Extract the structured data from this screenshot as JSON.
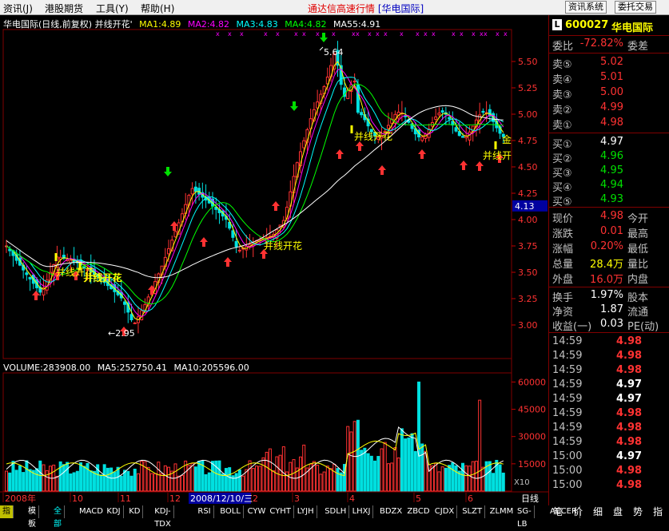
{
  "menubar": {
    "items": [
      "资讯(J)",
      "港股期货",
      "工具(Y)",
      "帮助(H)"
    ],
    "title": "通达信高速行情",
    "title_stock": "[华电国际]",
    "btn_info": "资讯系统",
    "btn_trade": "委托交易"
  },
  "chart_header": {
    "name": "华电国际(日线,前复权) 并线开花'",
    "ma1": "MA1:4.89",
    "ma2": "MA2:4.82",
    "ma3": "MA3:4.83",
    "ma4": "MA4:4.82",
    "ma5": "MA55:4.91"
  },
  "volume_header": {
    "vol": "VOLUME:283908.00",
    "ma5": "MA5:252750.41",
    "ma10": "MA10:205596.00"
  },
  "price_axis": [
    "5.50",
    "5.25",
    "5.00",
    "4.75",
    "4.50",
    "4.25",
    "4.00",
    "3.75",
    "3.50",
    "3.25",
    "3.00"
  ],
  "price_cursor": "4.13",
  "volume_axis": [
    "60000",
    "45000",
    "30000",
    "15000"
  ],
  "volume_unit": "X10",
  "time_axis": [
    "2008年",
    "10",
    "11",
    "12",
    "2",
    "3",
    "4",
    "5",
    "6"
  ],
  "time_highlight": "2008/12/10/三",
  "period_label": "日线",
  "annotations": {
    "high": "5.64",
    "low": "←2.95",
    "signal1": "并线开花",
    "signal2": "并线开花",
    "signal3": "并线开花",
    "signal4": "并线开花",
    "signal5": "并线开",
    "signal6": "并线开花",
    "signal7": "金"
  },
  "quote": {
    "code": "600027",
    "name": "华电国际",
    "icon": "L",
    "weibi_label": "委比",
    "weibi": "-72.82%",
    "weicha_label": "委差",
    "sells": [
      {
        "label": "卖⑤",
        "price": "5.02"
      },
      {
        "label": "卖④",
        "price": "5.01"
      },
      {
        "label": "卖③",
        "price": "5.00"
      },
      {
        "label": "卖②",
        "price": "4.99"
      },
      {
        "label": "卖①",
        "price": "4.98"
      }
    ],
    "buys": [
      {
        "label": "买①",
        "price": "4.97"
      },
      {
        "label": "买②",
        "price": "4.96"
      },
      {
        "label": "买③",
        "price": "4.95"
      },
      {
        "label": "买④",
        "price": "4.94"
      },
      {
        "label": "买⑤",
        "price": "4.93"
      }
    ],
    "stats": [
      {
        "label": "现价",
        "value": "4.98",
        "label2": "今开"
      },
      {
        "label": "涨跌",
        "value": "0.01",
        "label2": "最高"
      },
      {
        "label": "涨幅",
        "value": "0.20%",
        "label2": "最低"
      },
      {
        "label": "总量",
        "value": "28.4万",
        "label2": "量比"
      },
      {
        "label": "外盘",
        "value": "16.0万",
        "label2": "内盘"
      }
    ],
    "stats2": [
      {
        "label": "换手",
        "value": "1.97%",
        "label2": "股本"
      },
      {
        "label": "净资",
        "value": "1.87",
        "label2": "流通"
      },
      {
        "label": "收益(一)",
        "value": "0.03",
        "label2": "PE(动)"
      }
    ],
    "ticks": [
      {
        "t": "14:59",
        "p": "4.98",
        "c": "red"
      },
      {
        "t": "14:59",
        "p": "4.98",
        "c": "red"
      },
      {
        "t": "14:59",
        "p": "4.98",
        "c": "red"
      },
      {
        "t": "14:59",
        "p": "4.97",
        "c": "white"
      },
      {
        "t": "14:59",
        "p": "4.97",
        "c": "white"
      },
      {
        "t": "14:59",
        "p": "4.98",
        "c": "red"
      },
      {
        "t": "14:59",
        "p": "4.98",
        "c": "red"
      },
      {
        "t": "14:59",
        "p": "4.98",
        "c": "red"
      },
      {
        "t": "15:00",
        "p": "4.97",
        "c": "white"
      },
      {
        "t": "15:00",
        "p": "4.98",
        "c": "red"
      },
      {
        "t": "15:00",
        "p": "4.98",
        "c": "red"
      }
    ]
  },
  "bottom_tabs": [
    "指标",
    "模板",
    "全部",
    "MACD",
    "KDJ",
    "KD",
    "KDJ-TDX",
    "RSI",
    "BOLL",
    "CYW",
    "CYHT",
    "LYJH",
    "SDLH",
    "LHXJ",
    "BDZX",
    "ZBCD",
    "CJDX",
    "SLZT",
    "ZLMM",
    "SG-LB",
    "ACCER"
  ],
  "right_tabs": [
    "笔",
    "价",
    "细",
    "盘",
    "势",
    "指"
  ],
  "colors": {
    "up": "#ff3232",
    "down": "#00e000",
    "ma1": "#ffff00",
    "ma2": "#ff00ff",
    "ma3": "#00ffff",
    "ma4": "#00ff00",
    "ma5": "#ffffff"
  }
}
